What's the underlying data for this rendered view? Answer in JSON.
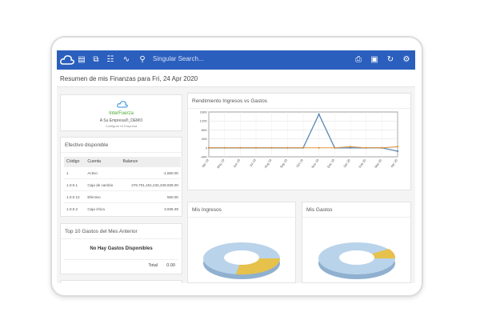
{
  "topbar": {
    "search_placeholder": "Singular Search...",
    "icons": [
      "cloud-icon",
      "document-icon",
      "share-icon",
      "table-icon",
      "chart-icon",
      "search-icon",
      "printer-icon",
      "window-icon",
      "refresh-icon",
      "gear-icon"
    ]
  },
  "page": {
    "title": "Resumen de mis Finanzas para Fri, 24 Apr 2020"
  },
  "company": {
    "logo_text": "InterFuerza",
    "name": "A Su Empresa®_DEMO",
    "sub": "Configure Hi Empresa"
  },
  "cash": {
    "title": "Efectivo disponible",
    "headers": [
      "Código",
      "Cuenta",
      "Balance"
    ],
    "rows": [
      {
        "code": "1",
        "account": "Activo",
        "balance": "-1,650.00"
      },
      {
        "code": "1.0.0.1",
        "account": "Caja de cambio",
        "balance": "276,701,161,234,348,928.00"
      },
      {
        "code": "1.0.0.12",
        "account": "Efectivo",
        "balance": "550.00"
      },
      {
        "code": "1.0.0.2",
        "account": "Caja chica",
        "balance": "3,936.39"
      }
    ]
  },
  "gastos": {
    "title": "Top 10 Gastos del Mes Anterior",
    "empty": "No Hay Gastos Disponibles",
    "total_label": "Total",
    "total_value": "0.00"
  },
  "ingresos": {
    "title": "Mis Ingresos"
  },
  "gastos_pie": {
    "title": "Mis Gastos"
  },
  "colors": {
    "topbar": "#2b5fbd",
    "income": "#5b87b3",
    "expense": "#e0933a",
    "pie_blue": "#b9d3ea",
    "pie_gold": "#e6c14b"
  },
  "chart_data": {
    "type": "line",
    "title": "Rendimiento Ingresos vs Gastos",
    "categories": [
      "Apr 19",
      "May 19",
      "Jun 19",
      "Jul 19",
      "Aug 19",
      "Sep 19",
      "Oct 19",
      "Nov 19",
      "Dec 19",
      "Jan 20",
      "Feb 20",
      "Mar 20",
      "Apr 20"
    ],
    "y_ticks": [
      "-40K",
      "0",
      "40K",
      "80K",
      "120K",
      "160K"
    ],
    "ylim": [
      -40000,
      160000
    ],
    "grid": true,
    "series": [
      {
        "values": [
          0,
          0,
          0,
          0,
          0,
          0,
          0,
          150000,
          0,
          0,
          0,
          0,
          -15000
        ]
      },
      {
        "values": [
          0,
          0,
          0,
          0,
          0,
          0,
          0,
          0,
          0,
          5000,
          0,
          0,
          5000
        ]
      }
    ]
  }
}
